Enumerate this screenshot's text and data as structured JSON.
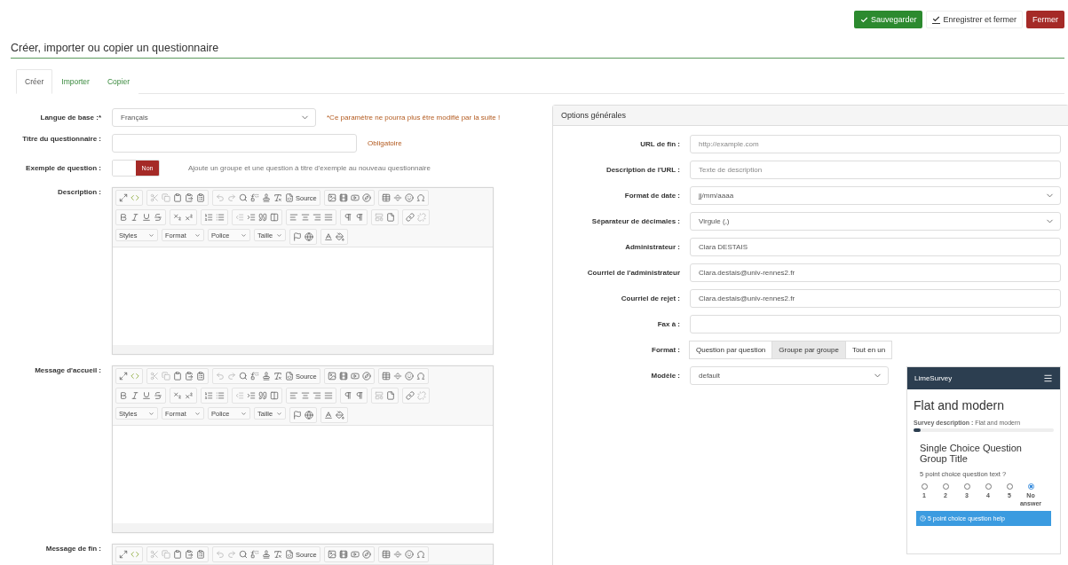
{
  "actions": [
    {
      "label": "Sauvegarder",
      "kind": "save"
    },
    {
      "label": "Enregistrer et fermer",
      "kind": "saveclose"
    },
    {
      "label": "Fermer",
      "kind": "close"
    }
  ],
  "page_title": "Créer, importer ou copier un questionnaire",
  "tabs": [
    {
      "label": "Créer",
      "selected": true
    },
    {
      "label": "Importer",
      "selected": false
    },
    {
      "label": "Copier",
      "selected": false
    }
  ],
  "form": {
    "language": {
      "label": "Langue de base :*",
      "value": "Français",
      "warning": "*Ce paramètre ne pourra plus être modifié par la suite !"
    },
    "title": {
      "label": "Titre du questionnaire :",
      "hint": "Obligatoire"
    },
    "example": {
      "label": "Exemple de question :",
      "toggle": "Non",
      "on": false,
      "help": "Ajoute un groupe et une question à titre d'exemple au nouveau questionnaire"
    }
  },
  "editors": [
    {
      "label": "Description :",
      "kind": "full",
      "source": "Source",
      "dropdowns": [
        "Styles",
        "Format",
        "Police",
        "Taille"
      ]
    },
    {
      "label": "Message d'accueil :",
      "kind": "full",
      "source": "Source",
      "dropdowns": [
        "Styles",
        "Format",
        "Police",
        "Taille"
      ]
    },
    {
      "label": "Message de fin :",
      "kind": "partial",
      "source": "Source"
    }
  ],
  "options": {
    "title": "Options générales",
    "fields": [
      {
        "label": "URL de fin :",
        "kind": "input",
        "placeholder": "http://example.com"
      },
      {
        "label": "Description de l'URL :",
        "kind": "input",
        "placeholder": "Texte de description"
      },
      {
        "label": "Format de date :",
        "kind": "select",
        "value": "jj/mm/aaaa"
      },
      {
        "label": "Séparateur de décimales :",
        "kind": "select",
        "value": "Virgule (,)"
      },
      {
        "label": "Administrateur :",
        "kind": "input",
        "value": "Clara DESTAIS"
      },
      {
        "label": "Courriel de l'administrateur",
        "kind": "input",
        "value": "Clara.destais@univ-rennes2.fr"
      },
      {
        "label": "Courriel de rejet :",
        "kind": "input",
        "value": "Clara.destais@univ-rennes2.fr"
      },
      {
        "label": "Fax à :",
        "kind": "input"
      },
      {
        "label": "Format :",
        "kind": "segmented",
        "options": [
          {
            "label": "Question par question",
            "selected": false
          },
          {
            "label": "Groupe par groupe",
            "selected": true
          },
          {
            "label": "Tout en un",
            "selected": false
          }
        ]
      },
      {
        "label": "Modèle :",
        "kind": "template",
        "value": "default"
      }
    ]
  },
  "preview": {
    "brand": "LimeSurvey",
    "title": "Flat and modern",
    "description": "**Survey description :** Flat and modern",
    "level": 0,
    "group_title": "Single Choice Question Group Title",
    "question": "5 point choice question text ?",
    "choices": [
      {
        "label": "1",
        "selected": false
      },
      {
        "label": "2",
        "selected": false
      },
      {
        "label": "3",
        "selected": false
      },
      {
        "label": "4",
        "selected": false
      },
      {
        "label": "5",
        "selected": false
      },
      {
        "label": "No answer",
        "selected": true
      }
    ],
    "help": "5 point choice question help"
  }
}
